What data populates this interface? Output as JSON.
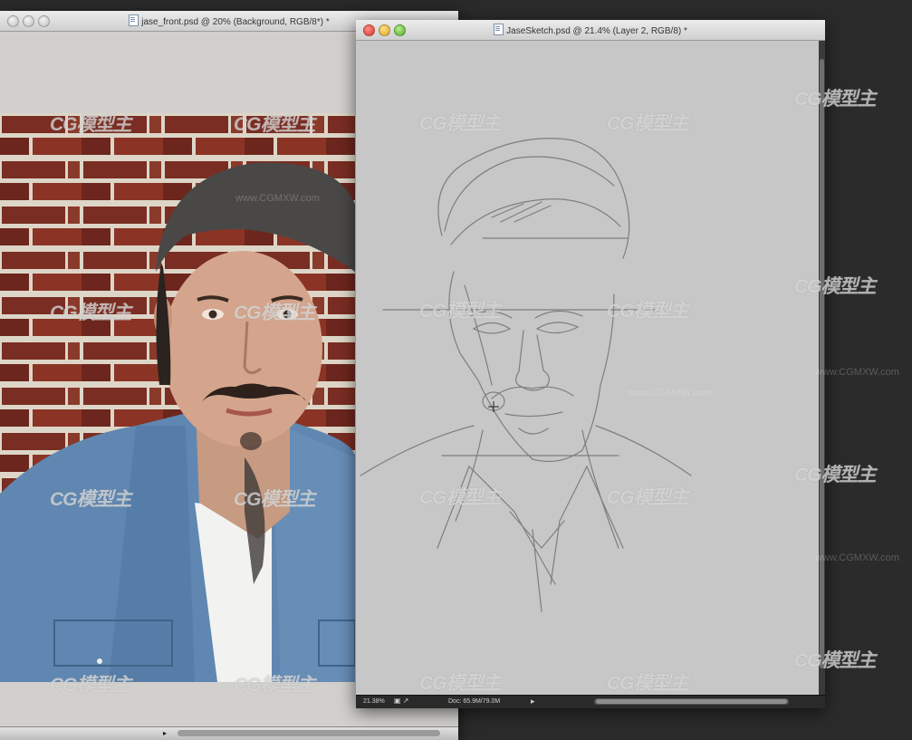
{
  "photo_window": {
    "title": "jase_front.psd @ 20% (Background, RGB/8*) *",
    "status_zoom": "",
    "status_doc": ""
  },
  "sketch_window": {
    "title": "JaseSketch.psd @ 21.4% (Layer 2, RGB/8) *",
    "status_zoom": "21.38%",
    "status_doc": "Doc: 65.9M/79.0M"
  },
  "watermark": {
    "logo_text": "CG模型主",
    "site_text": "www.CGMXW.com"
  },
  "colors": {
    "desktop": "#2b2b2b",
    "sketch_canvas": "#c7c7c7",
    "photo_bg": "#d2d0cc",
    "pencil": "#6a6a6a"
  }
}
